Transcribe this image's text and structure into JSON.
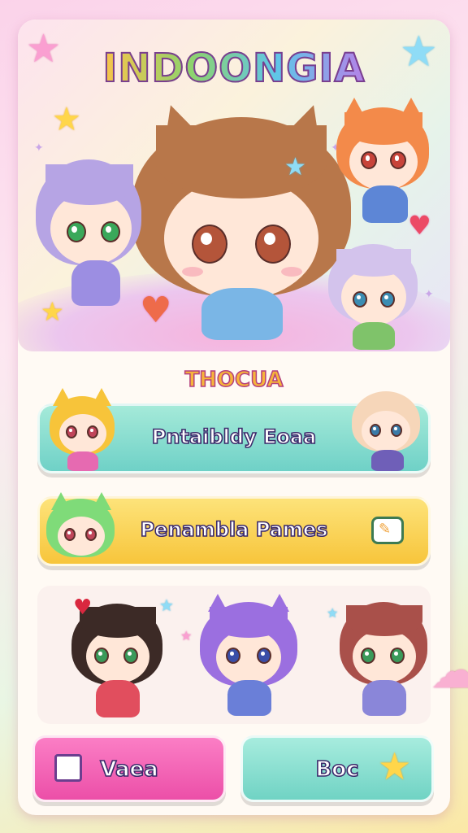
{
  "game": {
    "title": "INDOONGIA",
    "subtitle": "THOCUA"
  },
  "menu": {
    "items": [
      {
        "label": "Pntaibldy Eoaa",
        "color": "#7dd7c9"
      },
      {
        "label": "Penambla Pames",
        "color": "#f9cd47"
      }
    ]
  },
  "bottom": {
    "left_label": "Vaea",
    "right_label": "Boc"
  },
  "icons": {
    "left": "puzzle-icon",
    "right": "star-icon",
    "menu2": "game-card-icon"
  },
  "colors": {
    "accent_pink": "#ee56ab",
    "accent_mint": "#74d4c5",
    "accent_yellow": "#f8c73e"
  }
}
